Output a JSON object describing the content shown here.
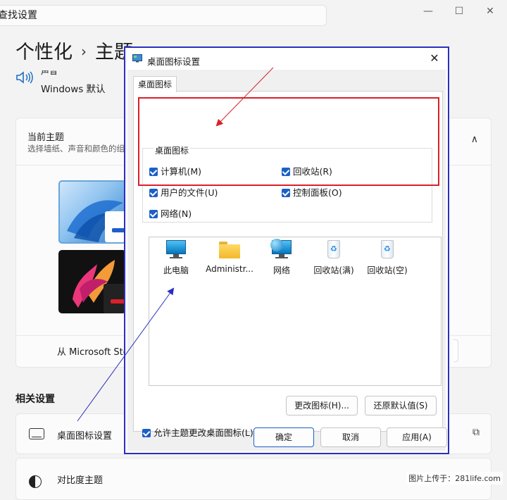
{
  "search": {
    "value": "查找设置"
  },
  "window_controls": {
    "minimize": "—",
    "maximize": "☐",
    "close": "✕"
  },
  "breadcrumb": {
    "parent": "个性化",
    "separator": "›",
    "current": "主题"
  },
  "sound": {
    "title": "声音",
    "value": "Windows 默认"
  },
  "current_theme": {
    "title": "当前主题",
    "subtitle": "选择墙纸、声音和颜色的组合",
    "store_text": "从 Microsoft Store"
  },
  "related": {
    "title": "相关设置",
    "desktop_icons": "桌面图标设置",
    "contrast": "对比度主题"
  },
  "dialog": {
    "title": "桌面图标设置",
    "tab": "桌面图标",
    "group_title": "桌面图标",
    "checkboxes": [
      {
        "label": "计算机(M)",
        "checked": true
      },
      {
        "label": "回收站(R)",
        "checked": true
      },
      {
        "label": "用户的文件(U)",
        "checked": true
      },
      {
        "label": "控制面板(O)",
        "checked": true
      },
      {
        "label": "网络(N)",
        "checked": true
      }
    ],
    "icons": [
      {
        "label": "此电脑",
        "icon": "computer-icon"
      },
      {
        "label": "Administr...",
        "icon": "folder-icon"
      },
      {
        "label": "网络",
        "icon": "network-icon"
      },
      {
        "label": "回收站(满)",
        "icon": "recycle-bin-full-icon"
      },
      {
        "label": "回收站(空)",
        "icon": "recycle-bin-empty-icon"
      }
    ],
    "change_icon_button": "更改图标(H)...",
    "restore_default_button": "还原默认值(S)",
    "allow_themes_checkbox": {
      "label": "允许主题更改桌面图标(L)",
      "checked": true
    },
    "ok_button": "确定",
    "cancel_button": "取消",
    "apply_button": "应用(A)"
  },
  "watermark": "图片上传于：281life.com",
  "colors": {
    "highlight_red": "#d9202a",
    "highlight_blue": "#2b2fbf",
    "accent": "#1c5fc8"
  }
}
